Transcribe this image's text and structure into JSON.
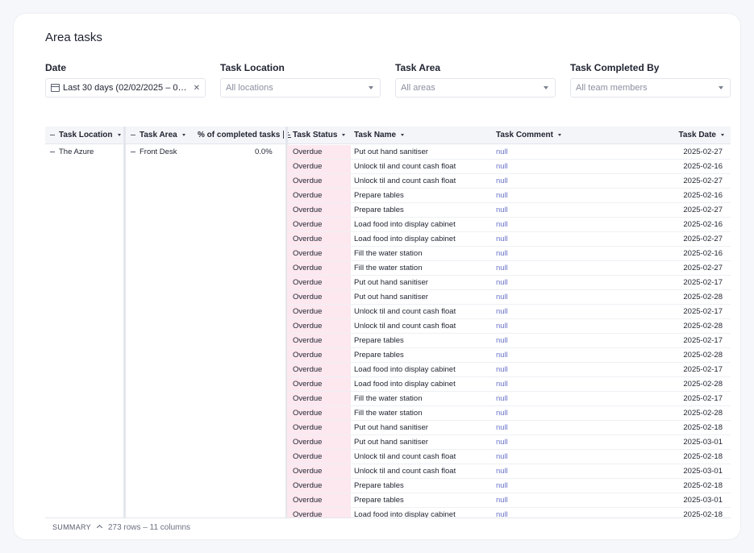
{
  "page": {
    "title": "Area tasks"
  },
  "filters": {
    "date": {
      "label": "Date",
      "value": "Last 30 days (02/02/2025 – 0…"
    },
    "location": {
      "label": "Task Location",
      "placeholder": "All locations"
    },
    "area": {
      "label": "Task Area",
      "placeholder": "All areas"
    },
    "completed_by": {
      "label": "Task Completed By",
      "placeholder": "All team members"
    }
  },
  "table": {
    "headers": {
      "location": "Task Location",
      "area": "Task Area",
      "pct": "% of completed tasks",
      "status": "Task Status",
      "name": "Task Name",
      "comment": "Task Comment",
      "date": "Task Date"
    },
    "group": {
      "location": "The Azure",
      "area": "Front Desk",
      "pct": "0.0%"
    },
    "rows": [
      {
        "status": "Overdue",
        "name": "Put out hand sanitiser",
        "comment": "null",
        "date": "2025-02-27"
      },
      {
        "status": "Overdue",
        "name": "Unlock til and count cash float",
        "comment": "null",
        "date": "2025-02-16"
      },
      {
        "status": "Overdue",
        "name": "Unlock til and count cash float",
        "comment": "null",
        "date": "2025-02-27"
      },
      {
        "status": "Overdue",
        "name": "Prepare tables",
        "comment": "null",
        "date": "2025-02-16"
      },
      {
        "status": "Overdue",
        "name": "Prepare tables",
        "comment": "null",
        "date": "2025-02-27"
      },
      {
        "status": "Overdue",
        "name": "Load food into display cabinet",
        "comment": "null",
        "date": "2025-02-16"
      },
      {
        "status": "Overdue",
        "name": "Load food into display cabinet",
        "comment": "null",
        "date": "2025-02-27"
      },
      {
        "status": "Overdue",
        "name": "Fill the water station",
        "comment": "null",
        "date": "2025-02-16"
      },
      {
        "status": "Overdue",
        "name": "Fill the water station",
        "comment": "null",
        "date": "2025-02-27"
      },
      {
        "status": "Overdue",
        "name": "Put out hand sanitiser",
        "comment": "null",
        "date": "2025-02-17"
      },
      {
        "status": "Overdue",
        "name": "Put out hand sanitiser",
        "comment": "null",
        "date": "2025-02-28"
      },
      {
        "status": "Overdue",
        "name": "Unlock til and count cash float",
        "comment": "null",
        "date": "2025-02-17"
      },
      {
        "status": "Overdue",
        "name": "Unlock til and count cash float",
        "comment": "null",
        "date": "2025-02-28"
      },
      {
        "status": "Overdue",
        "name": "Prepare tables",
        "comment": "null",
        "date": "2025-02-17"
      },
      {
        "status": "Overdue",
        "name": "Prepare tables",
        "comment": "null",
        "date": "2025-02-28"
      },
      {
        "status": "Overdue",
        "name": "Load food into display cabinet",
        "comment": "null",
        "date": "2025-02-17"
      },
      {
        "status": "Overdue",
        "name": "Load food into display cabinet",
        "comment": "null",
        "date": "2025-02-28"
      },
      {
        "status": "Overdue",
        "name": "Fill the water station",
        "comment": "null",
        "date": "2025-02-17"
      },
      {
        "status": "Overdue",
        "name": "Fill the water station",
        "comment": "null",
        "date": "2025-02-28"
      },
      {
        "status": "Overdue",
        "name": "Put out hand sanitiser",
        "comment": "null",
        "date": "2025-02-18"
      },
      {
        "status": "Overdue",
        "name": "Put out hand sanitiser",
        "comment": "null",
        "date": "2025-03-01"
      },
      {
        "status": "Overdue",
        "name": "Unlock til and count cash float",
        "comment": "null",
        "date": "2025-02-18"
      },
      {
        "status": "Overdue",
        "name": "Unlock til and count cash float",
        "comment": "null",
        "date": "2025-03-01"
      },
      {
        "status": "Overdue",
        "name": "Prepare tables",
        "comment": "null",
        "date": "2025-02-18"
      },
      {
        "status": "Overdue",
        "name": "Prepare tables",
        "comment": "null",
        "date": "2025-03-01"
      },
      {
        "status": "Overdue",
        "name": "Load food into display cabinet",
        "comment": "null",
        "date": "2025-02-18"
      }
    ]
  },
  "summary": {
    "label": "SUMMARY",
    "text": "273 rows – 11 columns"
  }
}
